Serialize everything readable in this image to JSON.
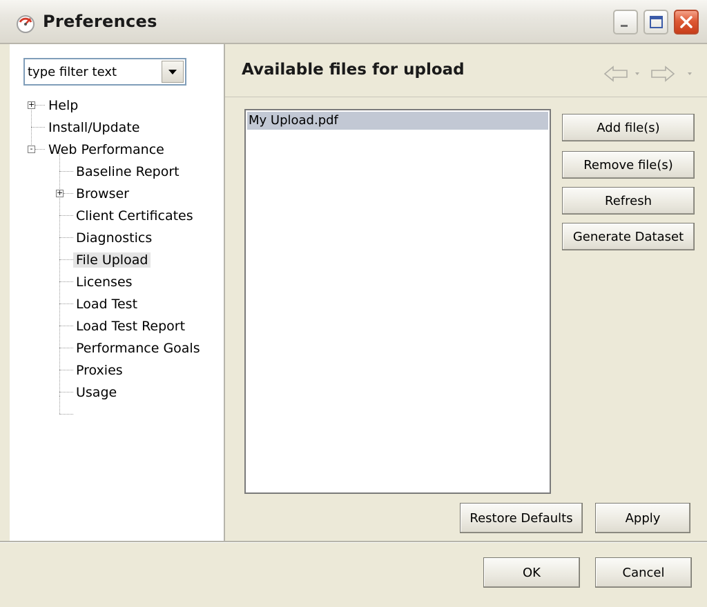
{
  "window": {
    "title": "Preferences",
    "controls": [
      "minimize",
      "maximize",
      "close"
    ]
  },
  "sidebar": {
    "filter": {
      "placeholder": "type filter text"
    },
    "tree": [
      {
        "label": "Help",
        "level": 0,
        "expander": "+"
      },
      {
        "label": "Install/Update",
        "level": 0,
        "expander": ""
      },
      {
        "label": "Web Performance",
        "level": 0,
        "expander": "-"
      },
      {
        "label": "Baseline Report",
        "level": 1,
        "expander": ""
      },
      {
        "label": "Browser",
        "level": 1,
        "expander": "+"
      },
      {
        "label": "Client Certificates",
        "level": 1,
        "expander": ""
      },
      {
        "label": "Diagnostics",
        "level": 1,
        "expander": ""
      },
      {
        "label": "File Upload",
        "level": 1,
        "expander": "",
        "selected": true
      },
      {
        "label": "Licenses",
        "level": 1,
        "expander": ""
      },
      {
        "label": "Load Test",
        "level": 1,
        "expander": ""
      },
      {
        "label": "Load Test Report",
        "level": 1,
        "expander": ""
      },
      {
        "label": "Performance Goals",
        "level": 1,
        "expander": ""
      },
      {
        "label": "Proxies",
        "level": 1,
        "expander": ""
      },
      {
        "label": "Usage",
        "level": 1,
        "expander": ""
      }
    ]
  },
  "main": {
    "title": "Available files for upload",
    "nav": {
      "back": "back-arrow-icon",
      "forward": "forward-arrow-icon"
    },
    "files": [
      "My Upload.pdf"
    ],
    "buttons": {
      "add": "Add file(s)",
      "remove": "Remove file(s)",
      "refresh": "Refresh",
      "generate": "Generate Dataset"
    },
    "restore_defaults": "Restore Defaults",
    "apply": "Apply"
  },
  "footer": {
    "ok": "OK",
    "cancel": "Cancel"
  },
  "colors": {
    "window_bg": "#ece9d8",
    "selection_bg": "#c2c8d4",
    "close_red": "#de5a35"
  }
}
